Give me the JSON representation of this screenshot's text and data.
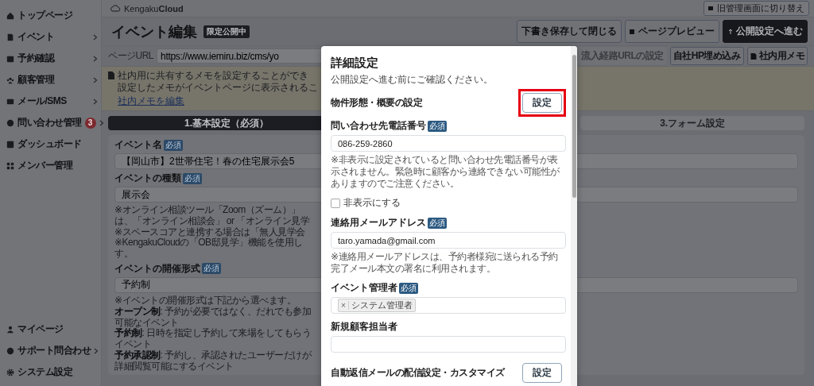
{
  "sidebar": {
    "items": [
      {
        "label": "トップページ",
        "submenu": false
      },
      {
        "label": "イベント",
        "submenu": true
      },
      {
        "label": "予約確認",
        "submenu": true
      },
      {
        "label": "顧客管理",
        "submenu": true
      },
      {
        "label": "メール/SMS",
        "submenu": true
      },
      {
        "label": "問い合わせ管理",
        "submenu": true,
        "badge": "3"
      },
      {
        "label": "ダッシュボード",
        "submenu": false
      },
      {
        "label": "メンバー管理",
        "submenu": false
      }
    ],
    "bottom_items": [
      {
        "label": "マイページ",
        "submenu": false
      },
      {
        "label": "サポート問合わせ",
        "submenu": true
      },
      {
        "label": "システム設定",
        "submenu": false
      }
    ]
  },
  "header": {
    "logo": "Kengaku**Cloud**",
    "switch_button": "旧管理画面に切り替え"
  },
  "title": "イベント編集",
  "status_badge": "限定公開中",
  "actions": [
    {
      "label": "下書き保存して閉じる",
      "kind": "outline"
    },
    {
      "label": "ページプレビュー",
      "kind": "outline"
    },
    {
      "label": "公開設定へ進む",
      "kind": "primary"
    }
  ],
  "url_row": {
    "label": "ページURL",
    "value": "https://www.iemiru.biz/cms/yo",
    "buttons": [
      {
        "label": "流入経路URLの設定",
        "disabled": true
      },
      {
        "label": "自社HP埋め込み",
        "disabled": false
      },
      {
        "label": "社内用メモ",
        "disabled": false
      }
    ]
  },
  "memo": {
    "lines": [
      "社内用に共有するメモを設定することができ",
      "設定したメモがイベントページに表示されるこ"
    ],
    "link": "社内メモを編集"
  },
  "steps": [
    {
      "label": "1.基本設定（必須）",
      "selected": true
    },
    {
      "label": "3.フォーム設定",
      "selected": false
    }
  ],
  "form": {
    "fields": [
      {
        "label": "イベント名",
        "required": "必須",
        "value": "【岡山市】2世帯住宅！春の住宅展示会5"
      },
      {
        "label": "イベントの種類",
        "required": "必須",
        "value": "展示会",
        "notes": [
          "※オンライン相談ツール「Zoom（ズーム）」",
          "は、「オンライン相談会」 or 「オンライン見学",
          "※スペースコアと連携する場合は「無人見学会",
          "※KengakuCloudの「OB邸見学」機能を使用し",
          "す。"
        ]
      },
      {
        "label": "イベントの開催形式",
        "required": "必須",
        "value": "予約制",
        "notes": [
          "※イベントの開催形式は下記から選べます。",
          "**オープン制**: 予約が必要ではなく、だれでも参加可能なイベント",
          "**予約制**: 日時を指定し予約して来場をしてもらうイベント",
          "**予約承認制**: 予約し、承認されたユーザーだけが詳細閲覧可能にするイベント"
        ]
      }
    ]
  },
  "modal": {
    "title": "詳細設定",
    "subtitle": "公開設定へ進む前にご確認ください。",
    "items": [
      {
        "kind": "setting",
        "label": "物件形態・概要の設定",
        "button": "設定",
        "highlighted": true
      },
      {
        "kind": "field",
        "label": "問い合わせ先電話番号",
        "required": "必須",
        "value": "086-259-2860",
        "note": "※非表示に設定されていると問い合わせ先電話番号が表示されません。緊急時に顧客から連絡できない可能性がありますのでご注意ください。"
      },
      {
        "kind": "checkbox",
        "label": "非表示にする",
        "checked": false
      },
      {
        "kind": "field",
        "label": "連絡用メールアドレス",
        "required": "必須",
        "value": "taro.yamada@gmail.com",
        "note": "※連絡用メールアドレスは、予約者様宛に送られる予約完了メール本文の署名に利用されます。"
      },
      {
        "kind": "tags",
        "label": "イベント管理者",
        "required": "必須",
        "tags": [
          {
            "remove": "×",
            "label": "システム管理者"
          }
        ]
      },
      {
        "kind": "field",
        "label": "新規顧客担当者"
      },
      {
        "kind": "setting",
        "label": "自動返信メールの配信設定・カスタマイズ",
        "button": "設定",
        "highlighted": false
      }
    ]
  }
}
